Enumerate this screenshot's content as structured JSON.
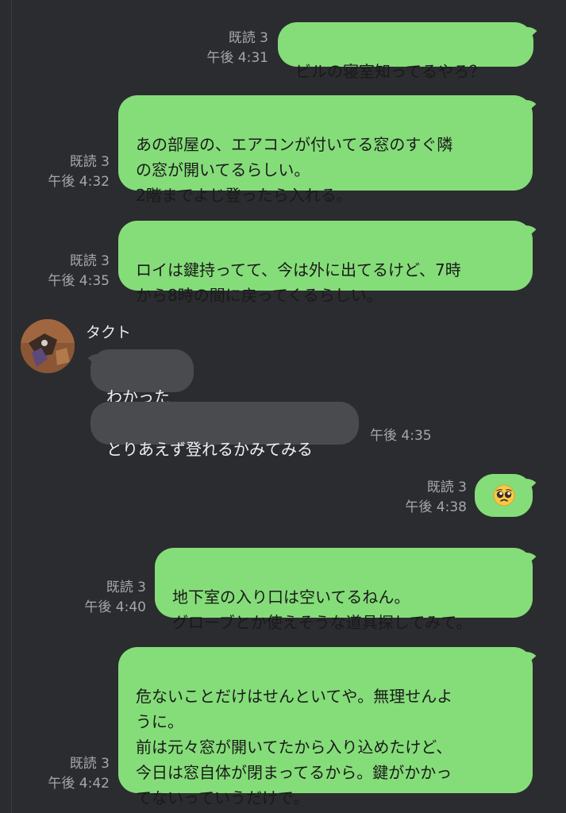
{
  "messages": [
    {
      "type": "out",
      "text": "ビルの寝室知ってるやろ？",
      "read": "既読 3",
      "time": "午後 4:31"
    },
    {
      "type": "out",
      "text": "あの部屋の、エアコンが付いてる窓のすぐ隣\nの窓が開いてるらしい。\n2階までよじ登ったら入れる。",
      "read": "既読 3",
      "time": "午後 4:32"
    },
    {
      "type": "out",
      "text": "ロイは鍵持ってて、今は外に出てるけど、7時\nから8時の間に戻ってくるらしい。",
      "read": "既読 3",
      "time": "午後 4:35"
    },
    {
      "type": "in",
      "sender": "タクト",
      "text": "わかった"
    },
    {
      "type": "in",
      "text": "とりあえず登れるかみてみる",
      "time": "午後 4:35"
    },
    {
      "type": "out",
      "emoji": "pleading-face",
      "read": "既読 3",
      "time": "午後 4:38"
    },
    {
      "type": "out",
      "text": "地下室の入り口は空いてるねん。\nグローブとか使えそうな道具探してみて。",
      "read": "既読 3",
      "time": "午後 4:40"
    },
    {
      "type": "out",
      "text": "危ないことだけはせんといてや。無理せんよ\nうに。\n前は元々窓が開いてたから入り込めたけど、\n今日は窓自体が閉まってるから。鍵がかかっ\nてないっていうだけで。",
      "read": "既読 3",
      "time": "午後 4:42"
    }
  ],
  "colors": {
    "background": "#2b2c2f",
    "outgoing_bubble": "#85dd79",
    "incoming_bubble": "#4a4b4f",
    "meta_text": "#a6a7ab"
  }
}
